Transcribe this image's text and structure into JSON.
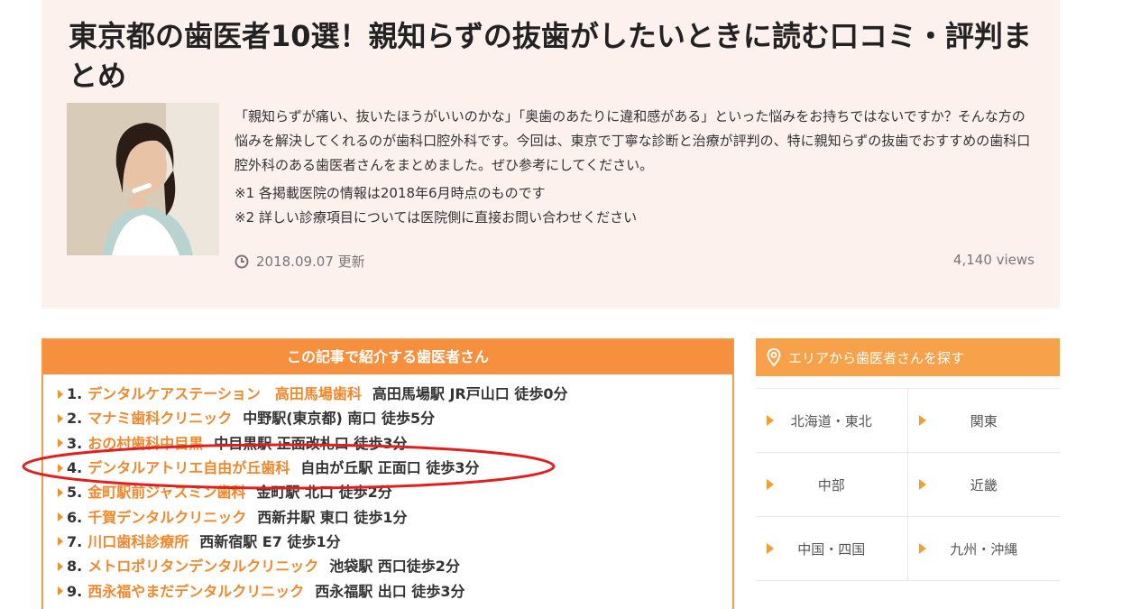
{
  "article": {
    "title": "東京都の歯医者10選！親知らずの抜歯がしたいときに読む口コミ・評判まとめ",
    "intro": "「親知らずが痛い、抜いたほうがいいのかな」「奥歯のあたりに違和感がある」といった悩みをお持ちではないですか？そんな方の悩みを解決してくれるのが歯科口腔外科です。今回は、東京で丁寧な診断と治療が評判の、特に親知らずの抜歯でおすすめの歯科口腔外科のある歯医者さんをまとめました。ぜひ参考にしてください。",
    "note1": "※1 各掲載医院の情報は2018年6月時点のものです",
    "note2": "※2 詳しい診療項目については医院側に直接お問い合わせください",
    "date": "2018.09.07 更新",
    "views": "4,140 views"
  },
  "toc": {
    "header": "この記事で紹介する歯医者さん",
    "items": [
      {
        "num": "1.",
        "name": "デンタルケアステーション　高田馬場歯科",
        "access": "高田馬場駅 JR戸山口 徒歩0分"
      },
      {
        "num": "2.",
        "name": "マナミ歯科クリニック",
        "access": "中野駅(東京都) 南口 徒歩5分"
      },
      {
        "num": "3.",
        "name": "おの村歯科中目黒",
        "access": "中目黒駅 正面改札口 徒歩3分"
      },
      {
        "num": "4.",
        "name": "デンタルアトリエ自由が丘歯科",
        "access": "自由が丘駅 正面口 徒歩3分"
      },
      {
        "num": "5.",
        "name": "金町駅前ジャスミン歯科",
        "access": "金町駅 北口 徒歩2分"
      },
      {
        "num": "6.",
        "name": "千賀デンタルクリニック",
        "access": "西新井駅 東口 徒歩1分"
      },
      {
        "num": "7.",
        "name": "川口歯科診療所",
        "access": "西新宿駅 E7 徒歩1分"
      },
      {
        "num": "8.",
        "name": "メトロポリタンデンタルクリニック",
        "access": "池袋駅 西口徒歩2分"
      },
      {
        "num": "9.",
        "name": "西永福やまだデンタルクリニック",
        "access": "西永福駅 出口 徒歩3分"
      }
    ]
  },
  "area": {
    "header": "エリアから歯医者さんを探す",
    "regions": [
      "北海道・東北",
      "関東",
      "中部",
      "近畿",
      "中国・四国",
      "九州・沖縄"
    ]
  },
  "icons": {
    "clock": "clock-icon",
    "pin": "map-pin-icon",
    "arrow": "triangle-right-icon"
  },
  "colors": {
    "accent": "#f7903e",
    "link": "#f0882c",
    "hero_bg": "#fdf1ee",
    "annotation": "#e02020"
  }
}
